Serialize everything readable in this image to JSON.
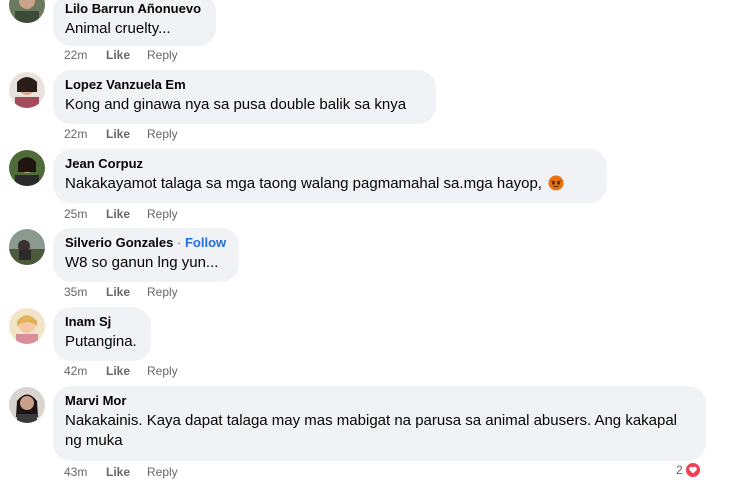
{
  "comments": [
    {
      "author": "Lilo Barrun Añonuevo",
      "text": "Animal cruelty...",
      "time": "22m",
      "like": "Like",
      "reply": "Reply"
    },
    {
      "author": "Lopez Vanzuela Em",
      "text": "Kong and ginawa nya sa pusa double balik sa knya",
      "time": "22m",
      "like": "Like",
      "reply": "Reply"
    },
    {
      "author": "Jean Corpuz",
      "text": "Nakakayamot talaga sa mga taong walang pagmamahal sa.mga hayop,",
      "emoji": "angry-face-icon",
      "time": "25m",
      "like": "Like",
      "reply": "Reply"
    },
    {
      "author": "Silverio Gonzales",
      "separator": "·",
      "follow": "Follow",
      "text": "W8 so ganun lng yun...",
      "time": "35m",
      "like": "Like",
      "reply": "Reply"
    },
    {
      "author": "Inam Sj",
      "text": "Putangina.",
      "time": "42m",
      "like": "Like",
      "reply": "Reply"
    },
    {
      "author": "Marvi Mor",
      "text": "Nakakainis. Kaya dapat talaga may mas mabigat na parusa sa animal abusers. Ang kakapal ng muka",
      "time": "43m",
      "like": "Like",
      "reply": "Reply",
      "reaction_count": "2"
    }
  ],
  "colors": {
    "bubble": "#f0f2f5",
    "meta": "#65676b",
    "follow": "#216fdb",
    "angry": "#e9710f",
    "love": "#f33e58"
  }
}
